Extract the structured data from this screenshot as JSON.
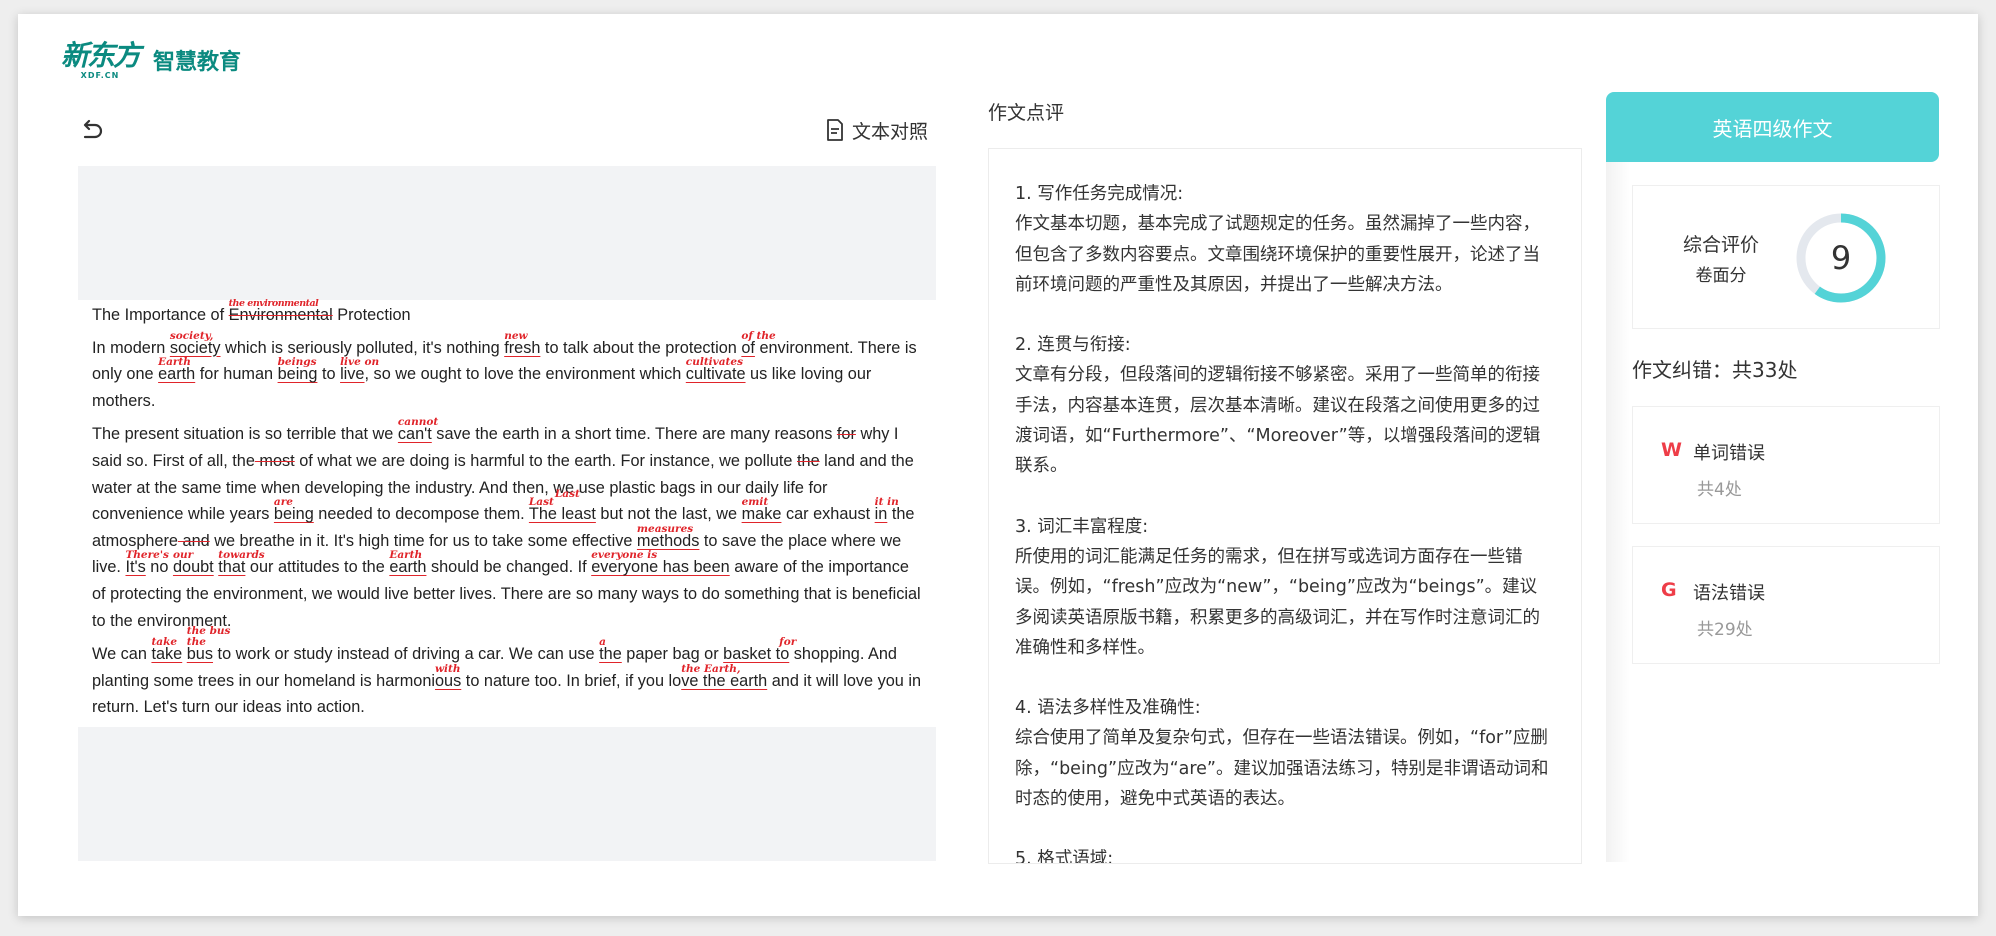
{
  "brand": {
    "name": "新东方",
    "domain": "XDF.CN",
    "product": "智慧教育"
  },
  "toolbar": {
    "compare_label": "文本对照"
  },
  "essay": {
    "title": [
      "The Importance of ",
      "Environmental",
      " Protection"
    ],
    "title_fix": "the environmental",
    "p1": [
      "In modern ",
      "society",
      " which is seriously polluted, it's nothing ",
      "fresh",
      " to talk about the protection ",
      "of",
      " environment. There is only one ",
      "earth",
      " for human ",
      "being",
      " to ",
      "live",
      ", so we ought to love the environment which ",
      "cultivate",
      " us like loving our mothers."
    ],
    "p1_fix": [
      "society,",
      "new",
      "of the",
      "Earth",
      "beings",
      "live on",
      "cultivates"
    ],
    "p2": [
      "The present situation is so terrible that we ",
      "can't",
      " save the earth in a short time. There are many reasons ",
      "for",
      " why I said so. First of all, the",
      " most",
      " of what we are doing is harmful to the earth. For instance, we pollute ",
      "the",
      " land and the water at the same time when developing the industry. And then, we use plastic bags in our daily life for convenience while years ",
      "being",
      " needed to decompose them. ",
      "The least",
      " but not the last, we ",
      "make",
      " car exhaust ",
      "in",
      " the atmosphere",
      " and",
      " we breathe in it. It's high time for us to take some effective ",
      "methods",
      " to save the place where we live. ",
      "It's",
      " no ",
      "doubt",
      " ",
      "that",
      " our attitudes to the ",
      "earth",
      " should be changed. If ",
      "everyone has been",
      " aware of the importance of protecting the environment, we would live better lives. There are so many ways to do something that is beneficial to the environment."
    ],
    "p2_fix": [
      "cannot",
      "are",
      "Last",
      "Last",
      "emit",
      "it in",
      "measures",
      "There's",
      "our",
      "towards",
      "Earth",
      "everyone is"
    ],
    "p3": [
      "We can ",
      "take",
      " ",
      "bus",
      " to work or study instead of driving a car. We can use ",
      "the",
      " paper bag or ",
      "basket to",
      " shopping. And planting some trees in our homeland is harmoni",
      "ous",
      " to nature too. In brief, if you lo",
      "ve the earth",
      " and it will love you in return. Let's turn our ideas into action."
    ],
    "p3_fix": [
      "take",
      "the bus",
      "the",
      "a",
      "for",
      "with",
      "the Earth,"
    ]
  },
  "review": {
    "title": "作文点评",
    "sections": [
      {
        "heading": "1. 写作任务完成情况:",
        "body": "作文基本切题，基本完成了试题规定的任务。虽然漏掉了一些内容，但包含了多数内容要点。文章围绕环境保护的重要性展开，论述了当前环境问题的严重性及其原因，并提出了一些解决方法。"
      },
      {
        "heading": "2. 连贯与衔接:",
        "body": "文章有分段，但段落间的逻辑衔接不够紧密。采用了一些简单的衔接手法，内容基本连贯，层次基本清晰。建议在段落之间使用更多的过渡词语，如“Furthermore”、“Moreover”等，以增强段落间的逻辑联系。"
      },
      {
        "heading": "3. 词汇丰富程度:",
        "body": "所使用的词汇能满足任务的需求，但在拼写或选词方面存在一些错误。例如，“fresh”应改为“new”，“being”应改为“beings”。建议多阅读英语原版书籍，积累更多的高级词汇，并在写作时注意词汇的准确性和多样性。"
      },
      {
        "heading": "4. 语法多样性及准确性:",
        "body": "综合使用了简单及复杂句式，但存在一些语法错误。例如，“for”应删除，“being”应改为“are”。建议加强语法练习，特别是非谓语动词和时态的使用，避免中式英语的表达。"
      },
      {
        "heading": "5. 格式语域:",
        "body": ""
      }
    ]
  },
  "panel": {
    "grade": "英语四级作文",
    "score_label": "综合评价",
    "score_sub": "卷面分",
    "score": "9",
    "score_fraction": 0.6,
    "error_total": "作文纠错：共33处",
    "word_err": {
      "icon": "W",
      "name": "单词错误",
      "count": "共4处"
    },
    "grammar_err": {
      "icon": "G",
      "name": "语法错误",
      "count": "共29处"
    }
  },
  "colors": {
    "accent": "#54d3d7",
    "brand": "#0b8a80",
    "error": "#e0242a"
  }
}
